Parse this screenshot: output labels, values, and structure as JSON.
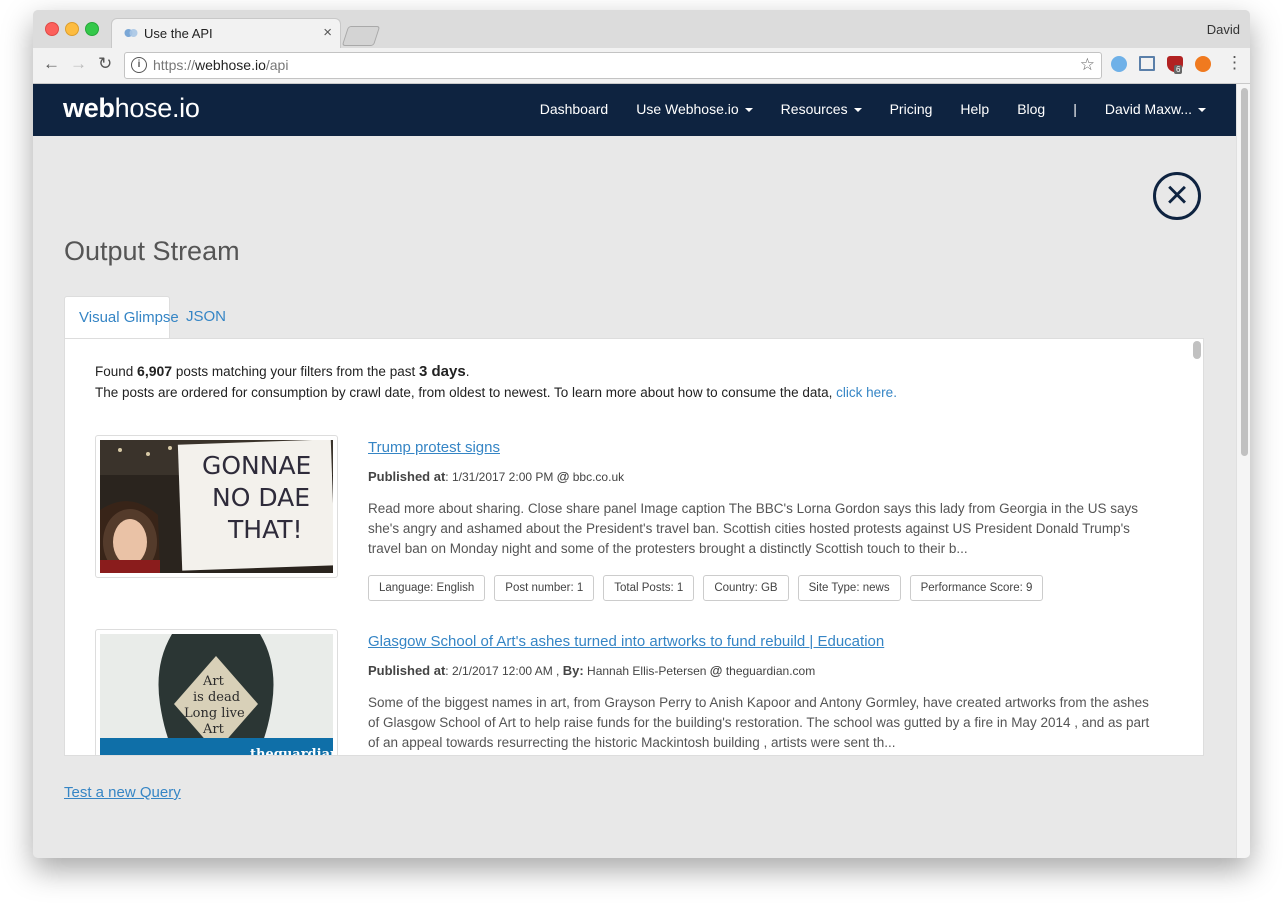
{
  "browser": {
    "tab_title": "Use the API",
    "tab_close": "×",
    "profile_name": "David",
    "url_scheme": "https://",
    "url_host": "webhose.io",
    "url_path": "/api",
    "extension_badge": "6"
  },
  "navbar": {
    "logo_bold": "web",
    "logo_rest": "hose.io",
    "items": [
      "Dashboard",
      "Use Webhose.io",
      "Resources",
      "Pricing",
      "Help",
      "Blog"
    ],
    "separator": "|",
    "user": "David Maxw..."
  },
  "main": {
    "heading": "Output Stream",
    "tabs": [
      "Visual Glimpse",
      "JSON"
    ],
    "active_tab": "Visual Glimpse"
  },
  "summary": {
    "found_prefix": "Found",
    "count": "6,907",
    "middle": "posts matching your filters from the past",
    "period": "3 days",
    "suffix": ".",
    "line2": "The posts are ordered for consumption by crawl date, from oldest to newest. To learn more about how to consume the data,",
    "link": "click here."
  },
  "posts": [
    {
      "title": "Trump protest signs",
      "published_label": "Published at",
      "published_value": ": 1/31/2017 2:00 PM",
      "by_label": "",
      "by_value": "",
      "source_prefix": "@",
      "source": "bbc.co.uk",
      "description": "Read more about sharing. Close share panel Image caption The BBC's Lorna Gordon says this lady from Georgia in the US says she's angry and ashamed about the President's travel ban. Scottish cities hosted protests against US President Donald Trump's travel ban on Monday night and some of the protesters brought a distinctly Scottish touch to their b...",
      "tags": [
        "Language: English",
        "Post number: 1",
        "Total Posts: 1",
        "Country: GB",
        "Site Type: news",
        "Performance Score: 9"
      ],
      "image_text": [
        "GONNAE",
        "NO DAE",
        "THAT!"
      ]
    },
    {
      "title": "Glasgow School of Art's ashes turned into artworks to fund rebuild | Education",
      "published_label": "Published at",
      "published_value": ": 2/1/2017 12:00 AM ,",
      "by_label": "By:",
      "by_value": "Hannah Ellis-Petersen",
      "source_prefix": "@",
      "source": "theguardian.com",
      "description": "Some of the biggest names in art, from Grayson Perry to Anish Kapoor and Antony Gormley, have created artworks from the ashes of Glasgow School of Art to help raise funds for the building's restoration. The school was gutted by a fire in May 2014 , and as part of an appeal towards resurrecting the historic Mackintosh building , artists were sent th...",
      "tags": [],
      "image_text": [
        "Art",
        "is dead",
        "Long live",
        "Art"
      ],
      "watermark": "theguardian"
    }
  ],
  "footer": {
    "link": "Test a new Query"
  }
}
